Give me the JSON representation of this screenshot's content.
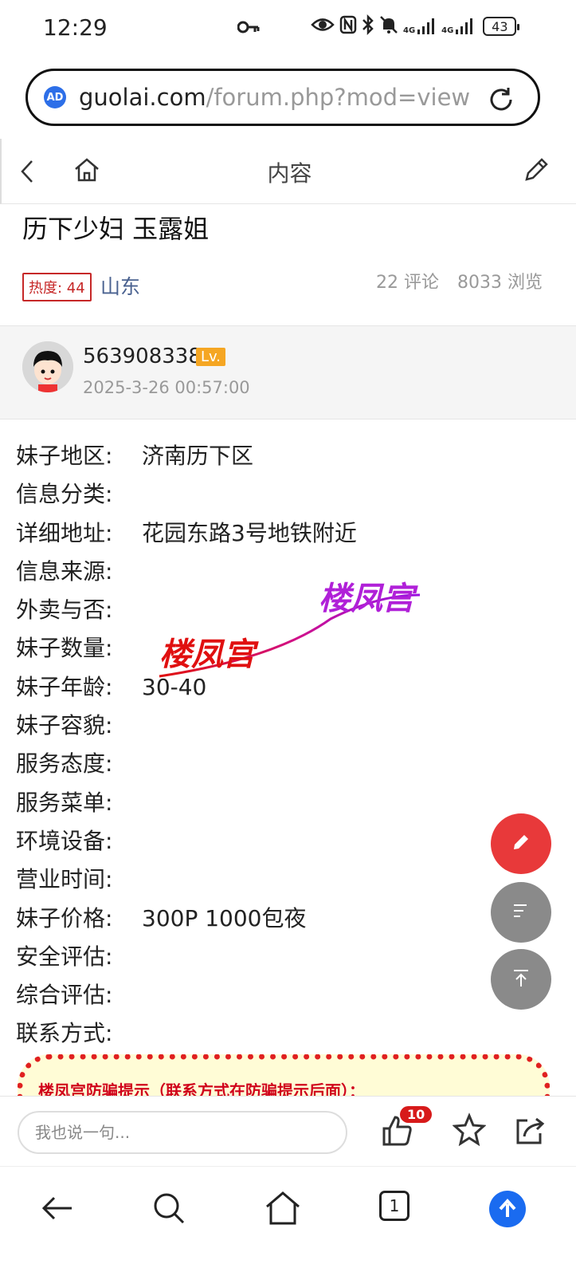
{
  "status": {
    "time": "12:29",
    "battery": "43",
    "net1": "4G",
    "net2": "4G"
  },
  "url": {
    "host": "guolai.com",
    "path": "/forum.php?mod=viewthr",
    "badge": "AD"
  },
  "pagenav": {
    "title": "内容"
  },
  "post": {
    "title": "历下少妇 玉露姐",
    "heat": "热度: 44",
    "region": "山东",
    "comments": "22 评论",
    "views": "8033 浏览"
  },
  "author": {
    "name": "563908338",
    "level": "Lv.",
    "date": "2025-3-26 00:57:00"
  },
  "info_rows": [
    {
      "k": "妹子地区:",
      "v": "济南历下区"
    },
    {
      "k": "信息分类:",
      "v": ""
    },
    {
      "k": "详细地址:",
      "v": "花园东路3号地铁附近"
    },
    {
      "k": "信息来源:",
      "v": ""
    },
    {
      "k": "外卖与否:",
      "v": ""
    },
    {
      "k": "妹子数量:",
      "v": ""
    },
    {
      "k": "妹子年龄:",
      "v": "30-40"
    },
    {
      "k": "妹子容貌:",
      "v": ""
    },
    {
      "k": "服务态度:",
      "v": ""
    },
    {
      "k": "服务菜单:",
      "v": ""
    },
    {
      "k": "环境设备:",
      "v": ""
    },
    {
      "k": "营业时间:",
      "v": ""
    },
    {
      "k": "妹子价格:",
      "v": "300P 1000包夜"
    },
    {
      "k": "安全评估:",
      "v": ""
    },
    {
      "k": "综合评估:",
      "v": ""
    },
    {
      "k": "联系方式:",
      "v": ""
    }
  ],
  "watermark": {
    "text1": "楼凤宫",
    "text2": "楼凤宫"
  },
  "warning": {
    "text": "楼凤宫防骗提示（联系方式在防骗提示后面）："
  },
  "commentbar": {
    "placeholder": "我也说一句...",
    "likes": "10"
  },
  "bottomnav": {
    "tabs": "1"
  },
  "colors": {
    "accent_red": "#e8393a",
    "link_blue": "#4a6290",
    "brand_blue": "#1a6bf0",
    "lv_orange": "#f5a623"
  }
}
